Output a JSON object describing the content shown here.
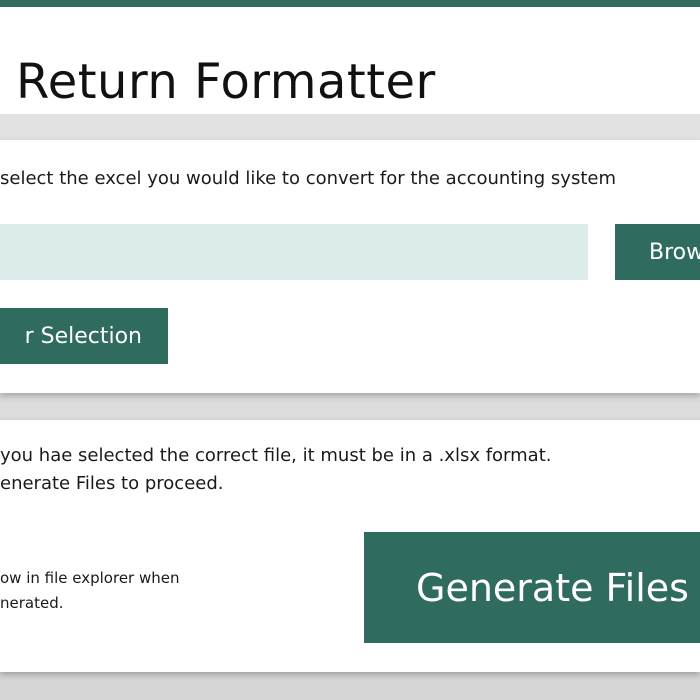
{
  "header": {
    "title": "Return Formatter"
  },
  "select_section": {
    "instruction": "select the excel you would like to convert for the accounting system",
    "file_path_input": {
      "value": "",
      "placeholder": ""
    },
    "browse_label": "Brow",
    "clear_label": "r Selection"
  },
  "generate_section": {
    "info_line1": "you hae selected the correct file, it must be in a .xlsx format.",
    "info_line2": "enerate Files to proceed.",
    "explorer_line1": "ow in file explorer when",
    "explorer_line2": "nerated.",
    "generate_label": "Generate Files"
  },
  "colors": {
    "accent": "#2f6b5e",
    "input_background": "#dbecea",
    "card_background": "#ffffff",
    "page_background": "#dcdcdc"
  }
}
